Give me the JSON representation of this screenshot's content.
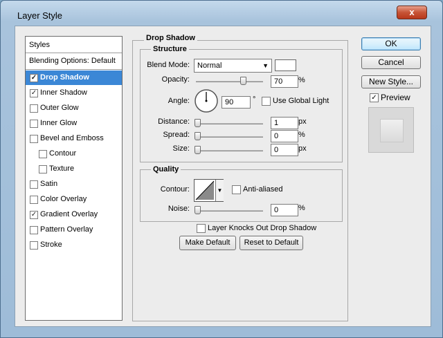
{
  "window": {
    "title": "Layer Style",
    "close_glyph": "x"
  },
  "styles_panel": {
    "header": "Styles",
    "blending": "Blending Options: Default",
    "items": [
      {
        "label": "Drop Shadow",
        "checked": true,
        "selected": true
      },
      {
        "label": "Inner Shadow",
        "checked": true
      },
      {
        "label": "Outer Glow",
        "checked": false
      },
      {
        "label": "Inner Glow",
        "checked": false
      },
      {
        "label": "Bevel and Emboss",
        "checked": false
      },
      {
        "label": "Contour",
        "checked": false,
        "sub": true
      },
      {
        "label": "Texture",
        "checked": false,
        "sub": true
      },
      {
        "label": "Satin",
        "checked": false
      },
      {
        "label": "Color Overlay",
        "checked": false
      },
      {
        "label": "Gradient Overlay",
        "checked": true
      },
      {
        "label": "Pattern Overlay",
        "checked": false
      },
      {
        "label": "Stroke",
        "checked": false
      }
    ]
  },
  "drop_shadow": {
    "title": "Drop Shadow",
    "structure": {
      "title": "Structure",
      "blend_mode_label": "Blend Mode:",
      "blend_mode_value": "Normal",
      "swatch_color": "#ffffff",
      "opacity_label": "Opacity:",
      "opacity_value": "70",
      "opacity_unit": "%",
      "angle_label": "Angle:",
      "angle_value": "90",
      "angle_unit": "°",
      "global_light_label": "Use Global Light",
      "distance_label": "Distance:",
      "distance_value": "1",
      "distance_unit": "px",
      "spread_label": "Spread:",
      "spread_value": "0",
      "spread_unit": "%",
      "size_label": "Size:",
      "size_value": "0",
      "size_unit": "px"
    },
    "quality": {
      "title": "Quality",
      "contour_label": "Contour:",
      "anti_aliased_label": "Anti-aliased",
      "noise_label": "Noise:",
      "noise_value": "0",
      "noise_unit": "%"
    },
    "knockout_label": "Layer Knocks Out Drop Shadow",
    "make_default": "Make Default",
    "reset_default": "Reset to Default"
  },
  "buttons": {
    "ok": "OK",
    "cancel": "Cancel",
    "new_style": "New Style...",
    "preview": "Preview"
  },
  "colors": {
    "selection": "#3b87d6",
    "window_frame": "#9ebcd8"
  }
}
